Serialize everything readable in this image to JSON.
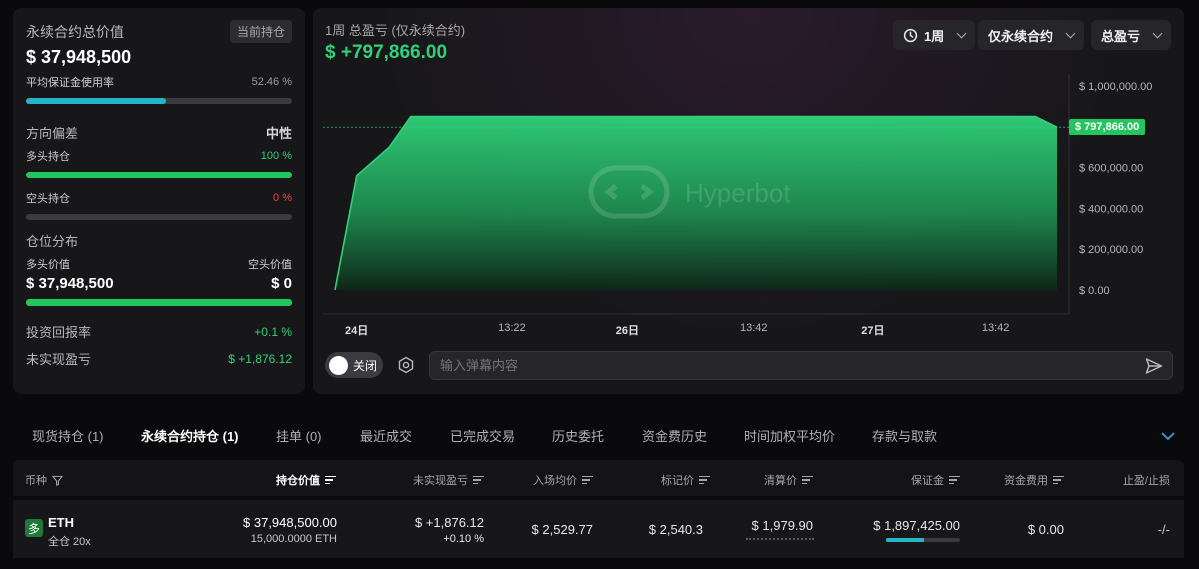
{
  "summary": {
    "total_label": "永续合约总价值",
    "current_positions_badge": "当前持仓",
    "total_value": "$ 37,948,500",
    "margin_usage_label": "平均保证金使用率",
    "margin_usage_value": "52.46 %",
    "margin_usage_fraction": 0.5246,
    "direction_label": "方向偏差",
    "direction_value": "中性",
    "long_label": "多头持仓",
    "long_pct": "100 %",
    "long_fraction": 1.0,
    "short_label": "空头持仓",
    "short_pct": "0 %",
    "short_fraction": 0.0,
    "distribution_label": "仓位分布",
    "long_value_label": "多头价值",
    "short_value_label": "空头价值",
    "long_value": "$ 37,948,500",
    "short_value": "$ 0",
    "distribution_fraction": 1.0,
    "roi_label": "投资回报率",
    "roi_value": "+0.1 %",
    "unrealized_label": "未实现盈亏",
    "unrealized_value": "$ +1,876.12"
  },
  "chart_header": {
    "title": "1周 总盈亏 (仅永续合约)",
    "value": "$ +797,866.00",
    "period_label": "1周",
    "filter_label": "仅永续合约",
    "metric_label": "总盈亏",
    "watermark": "Hyperbot",
    "toggle_label": "关闭",
    "comment_placeholder": "输入弹幕内容"
  },
  "chart_data": {
    "type": "area",
    "x_ticks": [
      {
        "label": "24日",
        "t": 0.03,
        "bold": true
      },
      {
        "label": "13:22",
        "t": 0.245,
        "bold": false
      },
      {
        "label": "26日",
        "t": 0.405,
        "bold": true
      },
      {
        "label": "13:42",
        "t": 0.58,
        "bold": false
      },
      {
        "label": "27日",
        "t": 0.745,
        "bold": true
      },
      {
        "label": "13:42",
        "t": 0.915,
        "bold": false
      }
    ],
    "y_ticks": [
      {
        "label": "$ 0.00",
        "v": 0
      },
      {
        "label": "$ 200,000.00",
        "v": 200000
      },
      {
        "label": "$ 400,000.00",
        "v": 400000
      },
      {
        "label": "$ 600,000.00",
        "v": 600000
      },
      {
        "label": "$ 1,000,000.00",
        "v": 1000000
      }
    ],
    "ylim": [
      0,
      1000000
    ],
    "points": [
      [
        0.0,
        0
      ],
      [
        0.03,
        560000
      ],
      [
        0.075,
        700000
      ],
      [
        0.105,
        850000
      ],
      [
        0.5,
        850000
      ],
      [
        0.97,
        850000
      ],
      [
        1.0,
        797866
      ]
    ],
    "current_label": "$ 797,866.00",
    "current_value": 797866,
    "color": "#2fd27a"
  },
  "tabs": [
    {
      "label": "现货持仓 (1)",
      "active": false
    },
    {
      "label": "永续合约持仓 (1)",
      "active": true
    },
    {
      "label": "挂单 (0)",
      "active": false
    },
    {
      "label": "最近成交",
      "active": false
    },
    {
      "label": "已完成交易",
      "active": false
    },
    {
      "label": "历史委托",
      "active": false
    },
    {
      "label": "资金费历史",
      "active": false
    },
    {
      "label": "时间加权平均价",
      "active": false
    },
    {
      "label": "存款与取款",
      "active": false
    }
  ],
  "table": {
    "headers": {
      "coin": "币种",
      "position_value": "持仓价值",
      "unrealized": "未实现盈亏",
      "entry": "入场均价",
      "mark": "标记价",
      "liq": "清算价",
      "margin": "保证金",
      "funding": "资金费用",
      "tpsl": "止盈/止损"
    },
    "row": {
      "side_badge": "多",
      "coin": "ETH",
      "mode": "全仓 20x",
      "position_value": "$ 37,948,500.00",
      "position_size": "15,000.0000 ETH",
      "unrealized": "$ +1,876.12",
      "unrealized_pct": "+0.10 %",
      "entry": "$ 2,529.77",
      "mark": "$ 2,540.3",
      "liq": "$ 1,979.90",
      "margin": "$ 1,897,425.00",
      "margin_fraction": 0.52,
      "funding": "$ 0.00",
      "tpsl": "-/-"
    }
  }
}
